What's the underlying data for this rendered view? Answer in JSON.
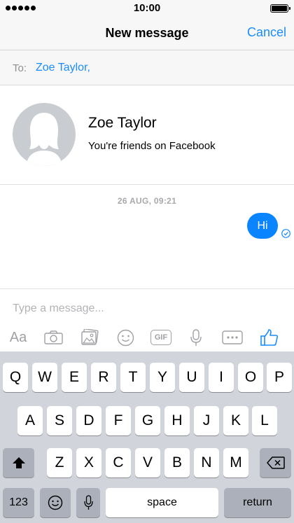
{
  "status_bar": {
    "time": "10:00"
  },
  "nav": {
    "title": "New message",
    "cancel_label": "Cancel"
  },
  "to_field": {
    "label": "To:",
    "value": "Zoe Taylor,"
  },
  "contact": {
    "name": "Zoe Taylor",
    "subtitle": "You're friends on Facebook"
  },
  "conversation": {
    "timestamp": "26 AUG, 09:21",
    "messages": [
      {
        "text": "Hi",
        "status": "delivered"
      }
    ]
  },
  "composer": {
    "placeholder": "Type a message...",
    "toolbar": [
      "text-format-icon",
      "camera-icon",
      "photo-gallery-icon",
      "emoji-icon",
      "gif-icon",
      "microphone-icon",
      "more-icon",
      "thumbs-up-icon"
    ],
    "toolbar_labels": {
      "aa": "Aa",
      "gif": "GIF"
    }
  },
  "keyboard": {
    "row1": [
      "Q",
      "W",
      "E",
      "R",
      "T",
      "Y",
      "U",
      "I",
      "O",
      "P"
    ],
    "row2": [
      "A",
      "S",
      "D",
      "F",
      "G",
      "H",
      "J",
      "K",
      "L"
    ],
    "row3": [
      "Z",
      "X",
      "C",
      "V",
      "B",
      "N",
      "M"
    ],
    "numbers_label": "123",
    "space_label": "space",
    "return_label": "return"
  },
  "colors": {
    "accent": "#1a8cff",
    "bubble": "#0a84ff",
    "keyboard_bg": "#d1d4da",
    "avatar": "#c9cdd2"
  }
}
